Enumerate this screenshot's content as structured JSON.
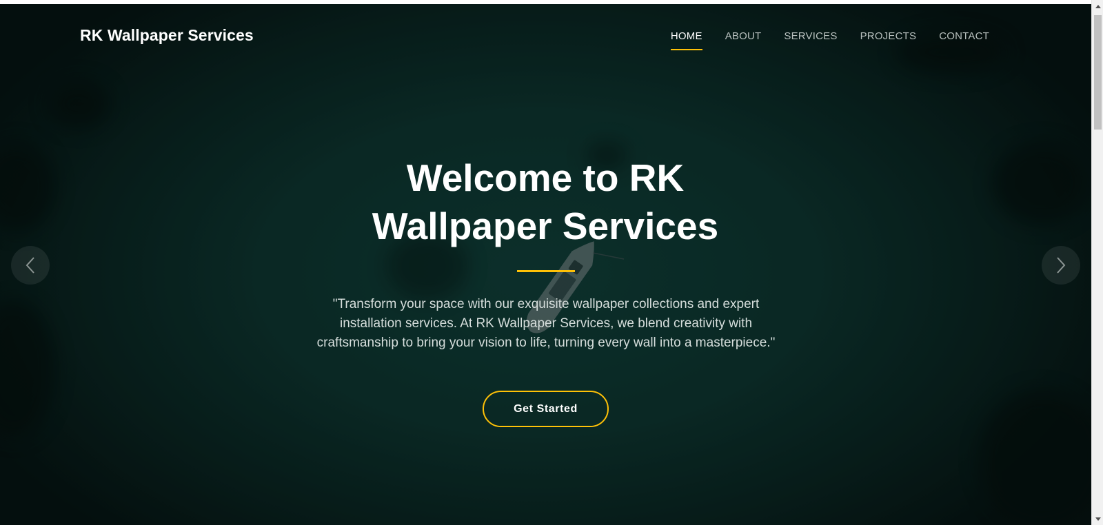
{
  "brand": {
    "name": "RK Wallpaper Services"
  },
  "nav": {
    "items": [
      {
        "label": "HOME",
        "active": true
      },
      {
        "label": "ABOUT",
        "active": false
      },
      {
        "label": "SERVICES",
        "active": false
      },
      {
        "label": "PROJECTS",
        "active": false
      },
      {
        "label": "CONTACT",
        "active": false
      }
    ]
  },
  "hero": {
    "title_line1": "Welcome to RK",
    "title_line2": "Wallpaper Services",
    "lead": "\"Transform your space with our exquisite wallpaper collections and expert installation services. At RK Wallpaper Services, we blend creativity with craftsmanship to bring your vision to life, turning every wall into a masterpiece.\"",
    "cta_label": "Get Started",
    "prev_icon": "chevron-left-icon",
    "next_icon": "chevron-right-icon"
  },
  "colors": {
    "accent": "#ffc107",
    "background": "#0c302c",
    "text": "#ffffff"
  }
}
